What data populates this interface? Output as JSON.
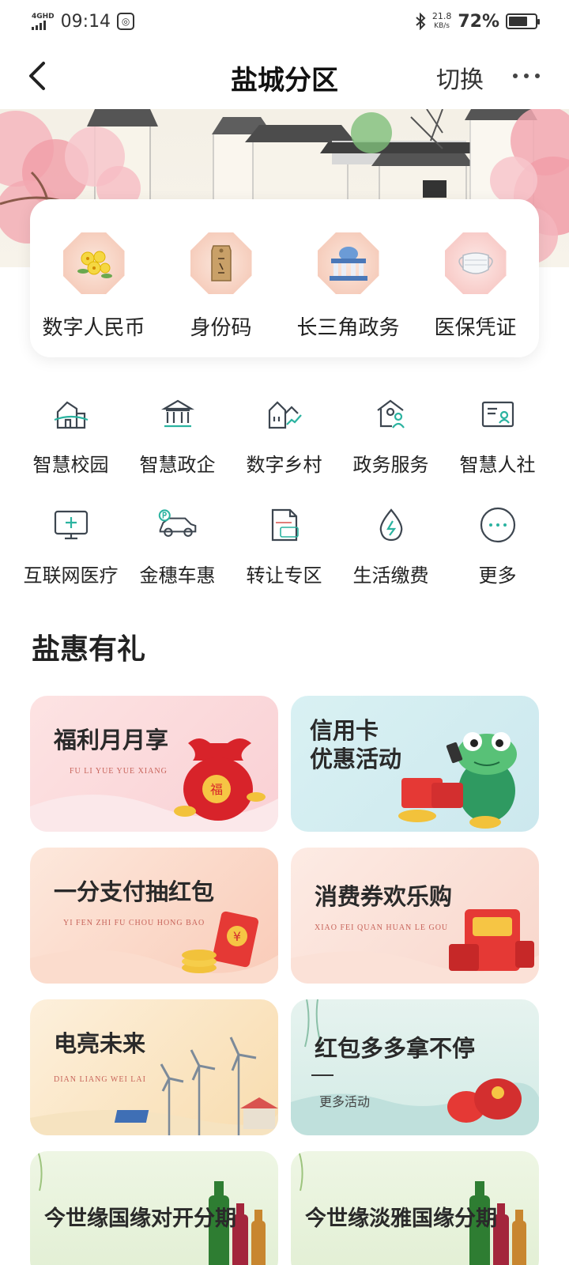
{
  "status_bar": {
    "network": "4GHD",
    "time": "09:14",
    "speed_value": "21.8",
    "speed_unit": "KB/s",
    "battery": "72%",
    "battery_level": 0.72
  },
  "nav": {
    "title": "盐城分区",
    "switch_label": "切换"
  },
  "quick_items": [
    {
      "label": "数字人民币",
      "icon": "flower-icon"
    },
    {
      "label": "身份码",
      "icon": "id-tag-icon"
    },
    {
      "label": "长三角政务",
      "icon": "government-building-icon"
    },
    {
      "label": "医保凭证",
      "icon": "mask-icon"
    }
  ],
  "services": [
    {
      "label": "智慧校园",
      "icon": "school-icon"
    },
    {
      "label": "智慧政企",
      "icon": "government-icon"
    },
    {
      "label": "数字乡村",
      "icon": "village-icon"
    },
    {
      "label": "政务服务",
      "icon": "service-house-icon"
    },
    {
      "label": "智慧人社",
      "icon": "id-card-icon"
    },
    {
      "label": "互联网医疗",
      "icon": "monitor-plus-icon"
    },
    {
      "label": "金穗车惠",
      "icon": "car-icon"
    },
    {
      "label": "转让专区",
      "icon": "transfer-document-icon"
    },
    {
      "label": "生活缴费",
      "icon": "water-drop-icon"
    },
    {
      "label": "更多",
      "icon": "more-circle-icon"
    }
  ],
  "section_title": "盐惠有礼",
  "promos": [
    {
      "title": "福利月月享",
      "subtitle": "FU LI YUE YUE XIANG"
    },
    {
      "title": "信用卡\n优惠活动",
      "subtitle": ""
    },
    {
      "title": "一分支付抽红包",
      "subtitle": "YI FEN ZHI FU CHOU HONG BAO"
    },
    {
      "title": "消费券欢乐购",
      "subtitle": "XIAO FEI QUAN HUAN LE GOU"
    },
    {
      "title": "电亮未来",
      "subtitle": "DIAN LIANG WEI LAI"
    },
    {
      "title": "红包多多拿不停",
      "more": "更多活动"
    },
    {
      "title": "今世缘国缘对开分期",
      "subtitle": ""
    },
    {
      "title": "今世缘淡雅国缘分期",
      "subtitle": ""
    }
  ]
}
